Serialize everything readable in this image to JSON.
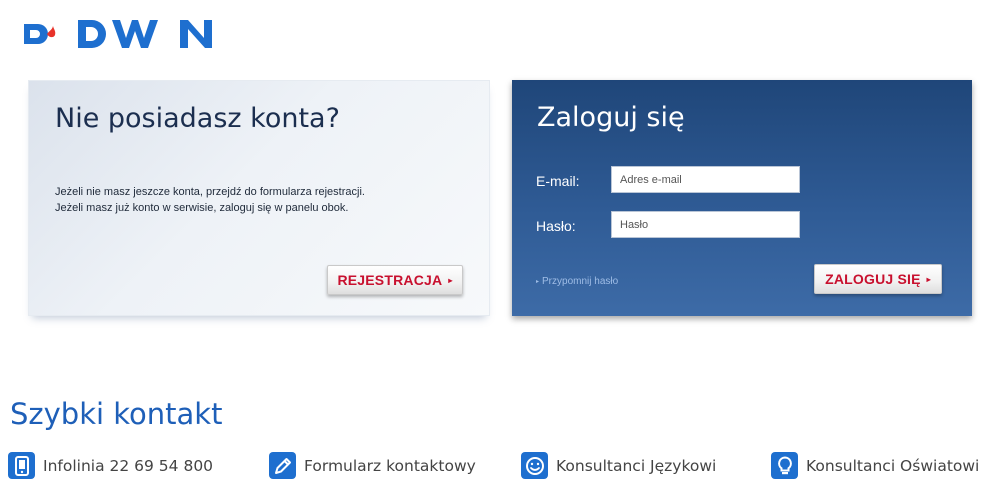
{
  "logo": {
    "text": "DWN"
  },
  "register_panel": {
    "title": "Nie posiadasz konta?",
    "text_line1": "Jeżeli nie masz jeszcze konta, przejdź do formularza rejestracji.",
    "text_line2": "Jeżeli masz już konto w serwisie, zaloguj się w panelu obok.",
    "button_label": "REJESTRACJA",
    "button_arrow": "▸"
  },
  "login_panel": {
    "title": "Zaloguj się",
    "email_label": "E-mail:",
    "email_placeholder": "Adres e-mail",
    "email_value": "",
    "password_label": "Hasło:",
    "password_placeholder": "Hasło",
    "password_value": "",
    "remind_label": "Przypomnij hasło",
    "remind_arrow": "▸",
    "button_label": "ZALOGUJ SIĘ",
    "button_arrow": "▸"
  },
  "contact": {
    "title": "Szybki kontakt",
    "items": [
      {
        "icon": "phone-icon",
        "label": "Infolinia 22 69 54 800"
      },
      {
        "icon": "pencil-icon",
        "label": "Formularz kontaktowy"
      },
      {
        "icon": "smiley-icon",
        "label": "Konsultanci Językowi"
      },
      {
        "icon": "lightbulb-icon",
        "label": "Konsultanci Oświatowi"
      }
    ]
  },
  "colors": {
    "brand_blue": "#1e5fb8",
    "button_red": "#c8102e",
    "login_panel_bg": "#2f5b95",
    "icon_bg": "#1e6fcf"
  }
}
